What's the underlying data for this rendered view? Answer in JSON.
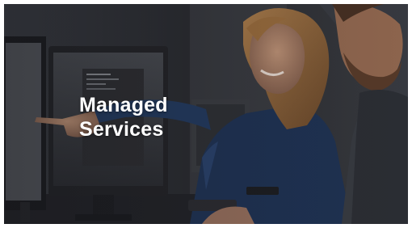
{
  "banner": {
    "title_line_1": "Managed",
    "title_line_2": "Services",
    "photo_subject": "professionals-at-computer-monitors",
    "text_color": "#ffffff"
  }
}
